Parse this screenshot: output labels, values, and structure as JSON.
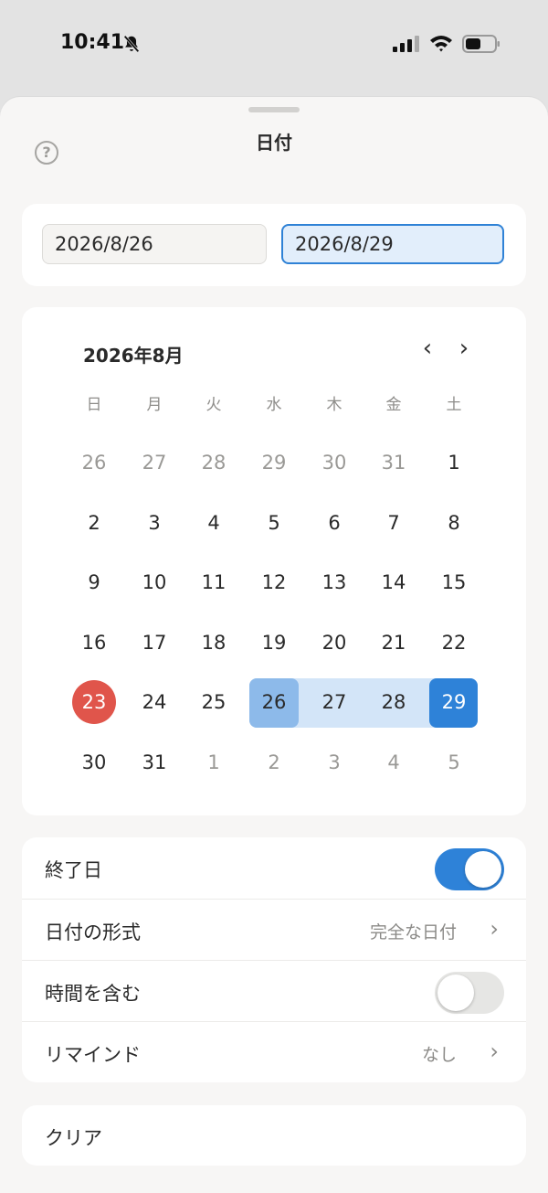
{
  "status": {
    "time": "10:41"
  },
  "sheet": {
    "title": "日付",
    "help": "?"
  },
  "inputs": {
    "start": "2026/8/26",
    "end": "2026/8/29"
  },
  "calendar": {
    "month": "2026年8月",
    "prev": "‹",
    "next": "›",
    "weekdays": [
      "日",
      "月",
      "火",
      "水",
      "木",
      "金",
      "土"
    ],
    "weeks": [
      [
        "26",
        "27",
        "28",
        "29",
        "30",
        "31",
        "1"
      ],
      [
        "2",
        "3",
        "4",
        "5",
        "6",
        "7",
        "8"
      ],
      [
        "9",
        "10",
        "11",
        "12",
        "13",
        "14",
        "15"
      ],
      [
        "16",
        "17",
        "18",
        "19",
        "20",
        "21",
        "22"
      ],
      [
        "23",
        "24",
        "25",
        "26",
        "27",
        "28",
        "29"
      ],
      [
        "30",
        "31",
        "1",
        "2",
        "3",
        "4",
        "5"
      ]
    ]
  },
  "settings": {
    "end_date": {
      "label": "終了日",
      "enabled": true
    },
    "format": {
      "label": "日付の形式",
      "value": "完全な日付"
    },
    "include_time": {
      "label": "時間を含む",
      "enabled": false
    },
    "reminder": {
      "label": "リマインド",
      "value": "なし"
    }
  },
  "clear": "クリア",
  "colors": {
    "accent": "#2e82d8",
    "today": "#e0554b",
    "range": "#d3e5f8"
  }
}
